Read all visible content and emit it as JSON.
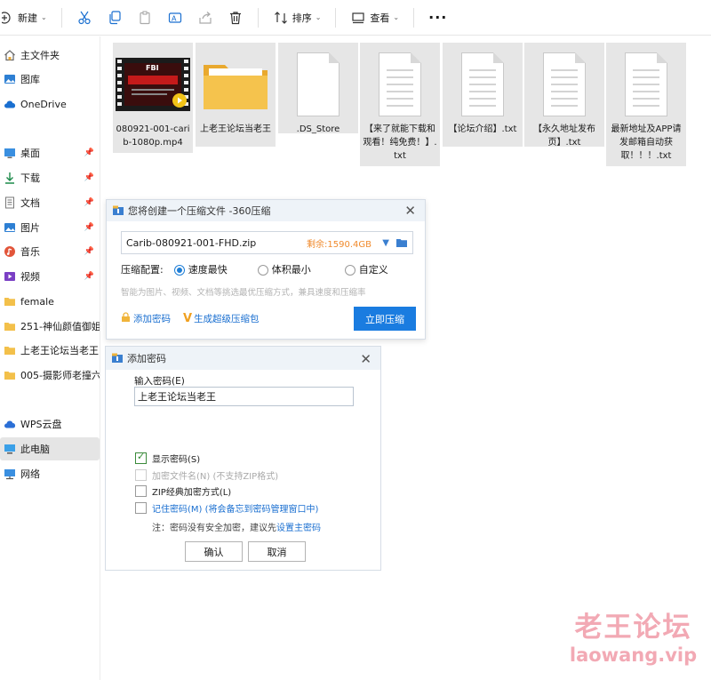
{
  "toolbar": {
    "new_label": "新建",
    "sort_label": "排序",
    "view_label": "查看",
    "more_label": "···"
  },
  "sidebar": {
    "items": [
      {
        "label": "主文件夹",
        "icon": "home-icon"
      },
      {
        "label": "图库",
        "icon": "gallery-icon"
      },
      {
        "label": "OneDrive",
        "icon": "cloud-icon"
      },
      {
        "label": "桌面",
        "icon": "desktop-icon"
      },
      {
        "label": "下载",
        "icon": "download-icon"
      },
      {
        "label": "文档",
        "icon": "document-icon"
      },
      {
        "label": "图片",
        "icon": "picture-icon"
      },
      {
        "label": "音乐",
        "icon": "music-icon"
      },
      {
        "label": "视频",
        "icon": "video-icon"
      },
      {
        "label": "female",
        "icon": "folder-icon"
      },
      {
        "label": "251-神仙颜值御姐",
        "icon": "folder-icon"
      },
      {
        "label": "上老王论坛当老王",
        "icon": "folder-icon"
      },
      {
        "label": "005-摄影师老撞六",
        "icon": "folder-icon"
      },
      {
        "label": "WPS云盘",
        "icon": "wps-cloud-icon"
      },
      {
        "label": "此电脑",
        "icon": "computer-icon"
      },
      {
        "label": "网络",
        "icon": "network-icon"
      }
    ]
  },
  "files": [
    {
      "name": "080921-001-carib-1080p.mp4",
      "type": "video"
    },
    {
      "name": "上老王论坛当老王",
      "type": "folder"
    },
    {
      "name": ".DS_Store",
      "type": "blank"
    },
    {
      "name": "【来了就能下载和观看！纯免费！】.txt",
      "type": "text"
    },
    {
      "name": "【论坛介绍】.txt",
      "type": "text"
    },
    {
      "name": "【永久地址发布页】.txt",
      "type": "text"
    },
    {
      "name": "最新地址及APP请发邮箱自动获取！！！.txt",
      "type": "text"
    }
  ],
  "video_thumb_text": "FBI",
  "compress_dialog": {
    "title": "您将创建一个压缩文件 -360压缩",
    "filename": "Carib-080921-001-FHD.zip",
    "remaining": "剩余:1590.4GB",
    "config_label": "压缩配置:",
    "options": [
      "速度最快",
      "体积最小",
      "自定义"
    ],
    "selected_option": "速度最快",
    "hint": "智能为图片、视频、文档等挑选最优压缩方式，兼具速度和压缩率",
    "add_password": "添加密码",
    "super_pack": "生成超级压缩包",
    "compress_button": "立即压缩"
  },
  "password_dialog": {
    "title": "添加密码",
    "input_label": "输入密码(E)",
    "password_value": "上老王论坛当老王",
    "show_password": "显示密码(S)",
    "encrypt_filename": "加密文件名(N) (不支持ZIP格式)",
    "zip_classic": "ZIP经典加密方式(L)",
    "remember": "记住密码(M) (将会备忘到密码管理窗口中)",
    "note": "注：密码没有安全加密，建议先",
    "note_link": "设置主密码",
    "ok_button": "确认",
    "cancel_button": "取消"
  },
  "watermark": {
    "cn": "老王论坛",
    "url": "laowang.vip"
  },
  "colors": {
    "accent": "#1a7ce0",
    "selection": "#e6e6e6",
    "watermark": "#f2a9b4"
  }
}
